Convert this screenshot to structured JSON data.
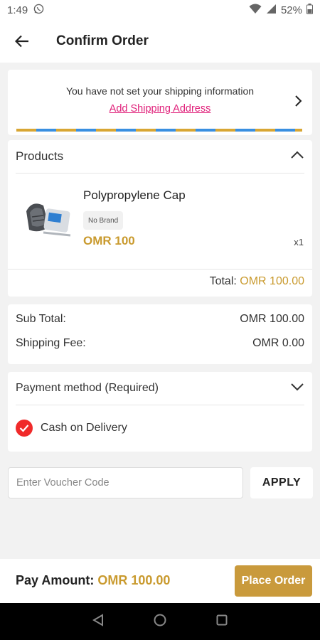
{
  "status_bar": {
    "time": "1:49",
    "battery": "52%"
  },
  "app_bar": {
    "title": "Confirm Order"
  },
  "shipping": {
    "notice": "You have not set your shipping information",
    "link": "Add Shipping Address"
  },
  "products": {
    "header": "Products",
    "items": [
      {
        "name": "Polypropylene Cap",
        "brand": "No Brand",
        "price": "OMR 100",
        "quantity": "x1"
      }
    ],
    "total_label": "Total:",
    "total_value": "OMR 100.00"
  },
  "summary": {
    "subtotal_label": "Sub Total:",
    "subtotal_value": "OMR 100.00",
    "shipping_label": "Shipping Fee:",
    "shipping_value": "OMR 0.00"
  },
  "payment": {
    "header": "Payment method (Required)",
    "selected_option": "Cash on Delivery"
  },
  "voucher": {
    "placeholder": "Enter Voucher Code",
    "apply_label": "APPLY"
  },
  "footer": {
    "pay_label": "Pay Amount:",
    "pay_value": "OMR 100.00",
    "place_order_label": "Place Order"
  },
  "colors": {
    "accent": "#c99a2e",
    "link": "#e0207a",
    "check": "#f02a2a"
  }
}
